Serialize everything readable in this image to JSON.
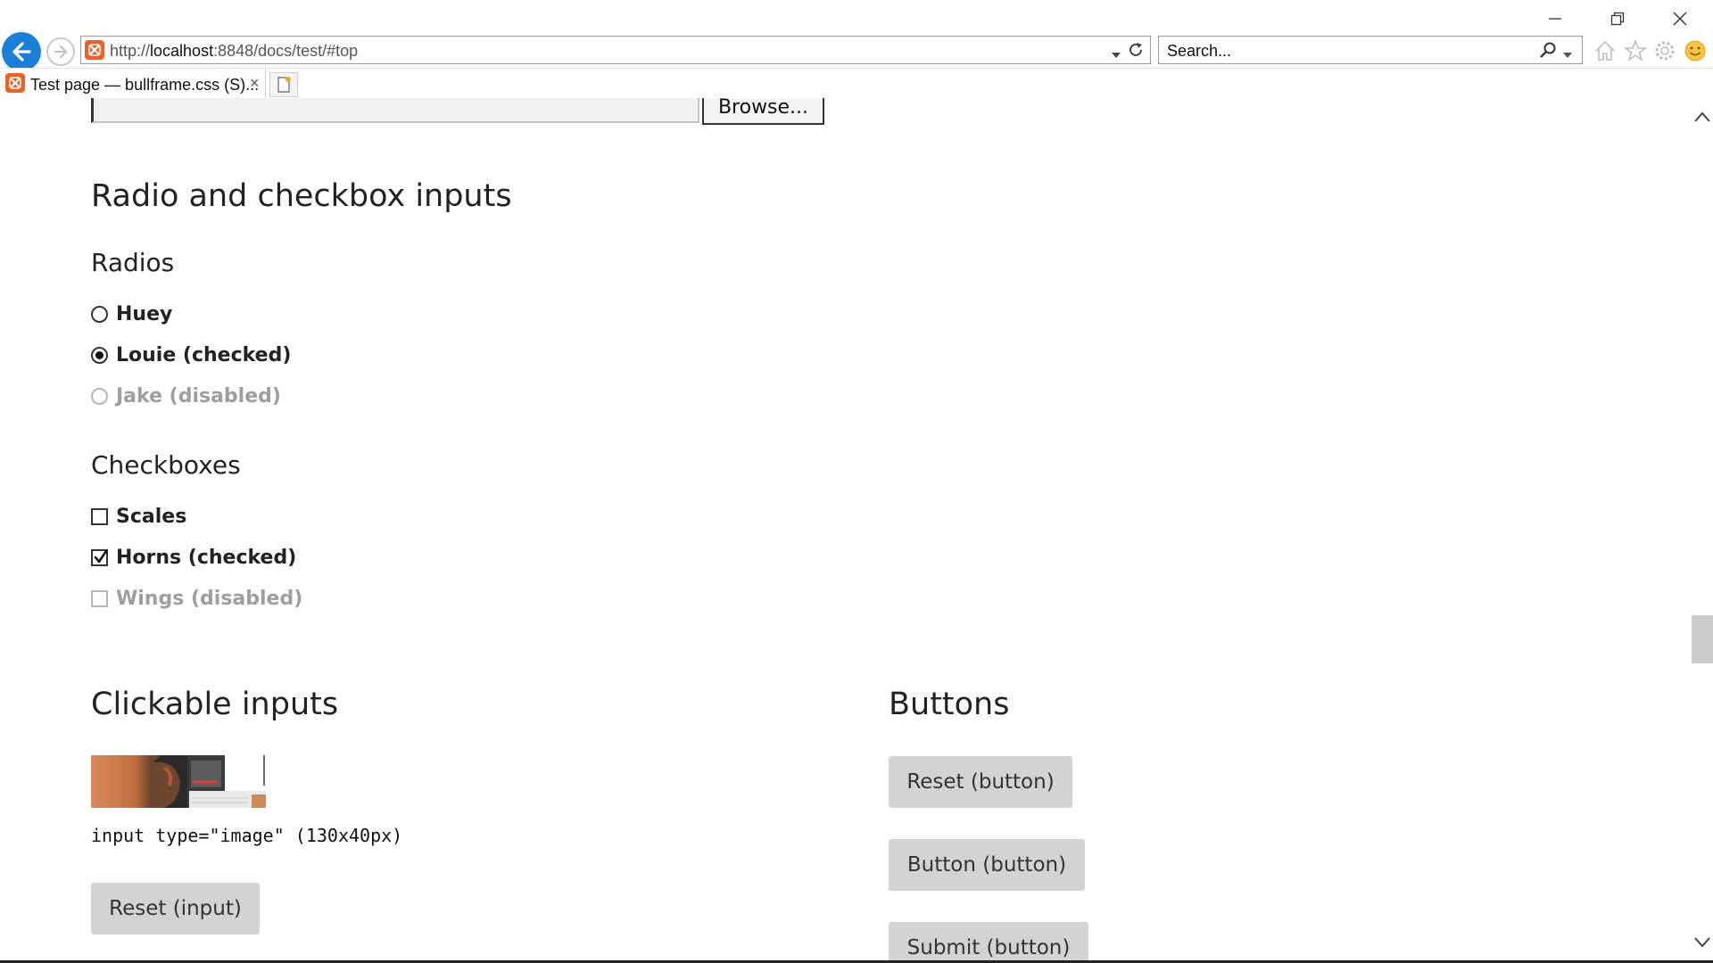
{
  "browser": {
    "url_prefix": "http://",
    "url_host": "localhost",
    "url_rest": ":8848/docs/test/#top",
    "search_placeholder": "Search...",
    "tab_title": "Test page — bullframe.css (S)...",
    "tab_close": "×"
  },
  "form": {
    "browse_label": "Browse..."
  },
  "sections": {
    "radio_checkbox_heading": "Radio and checkbox inputs",
    "radios_heading": "Radios",
    "radios": [
      {
        "label": "Huey",
        "checked": false,
        "disabled": false
      },
      {
        "label": "Louie (checked)",
        "checked": true,
        "disabled": false
      },
      {
        "label": "Jake (disabled)",
        "checked": false,
        "disabled": true
      }
    ],
    "checkboxes_heading": "Checkboxes",
    "checkboxes": [
      {
        "label": "Scales",
        "checked": false,
        "disabled": false
      },
      {
        "label": "Horns (checked)",
        "checked": true,
        "disabled": false
      },
      {
        "label": "Wings (disabled)",
        "checked": false,
        "disabled": true
      }
    ],
    "clickable_heading": "Clickable inputs",
    "image_input_caption": "input type=\"image\" (130x40px)",
    "reset_input_label": "Reset (input)",
    "buttons_heading": "Buttons",
    "buttons": [
      "Reset (button)",
      "Button (button)",
      "Submit (button)"
    ]
  },
  "colors": {
    "accent": "#1b7fd8",
    "favicon": "#e8622c",
    "button_bg": "#d3d3d3",
    "disabled_text": "#9e9e9e"
  }
}
